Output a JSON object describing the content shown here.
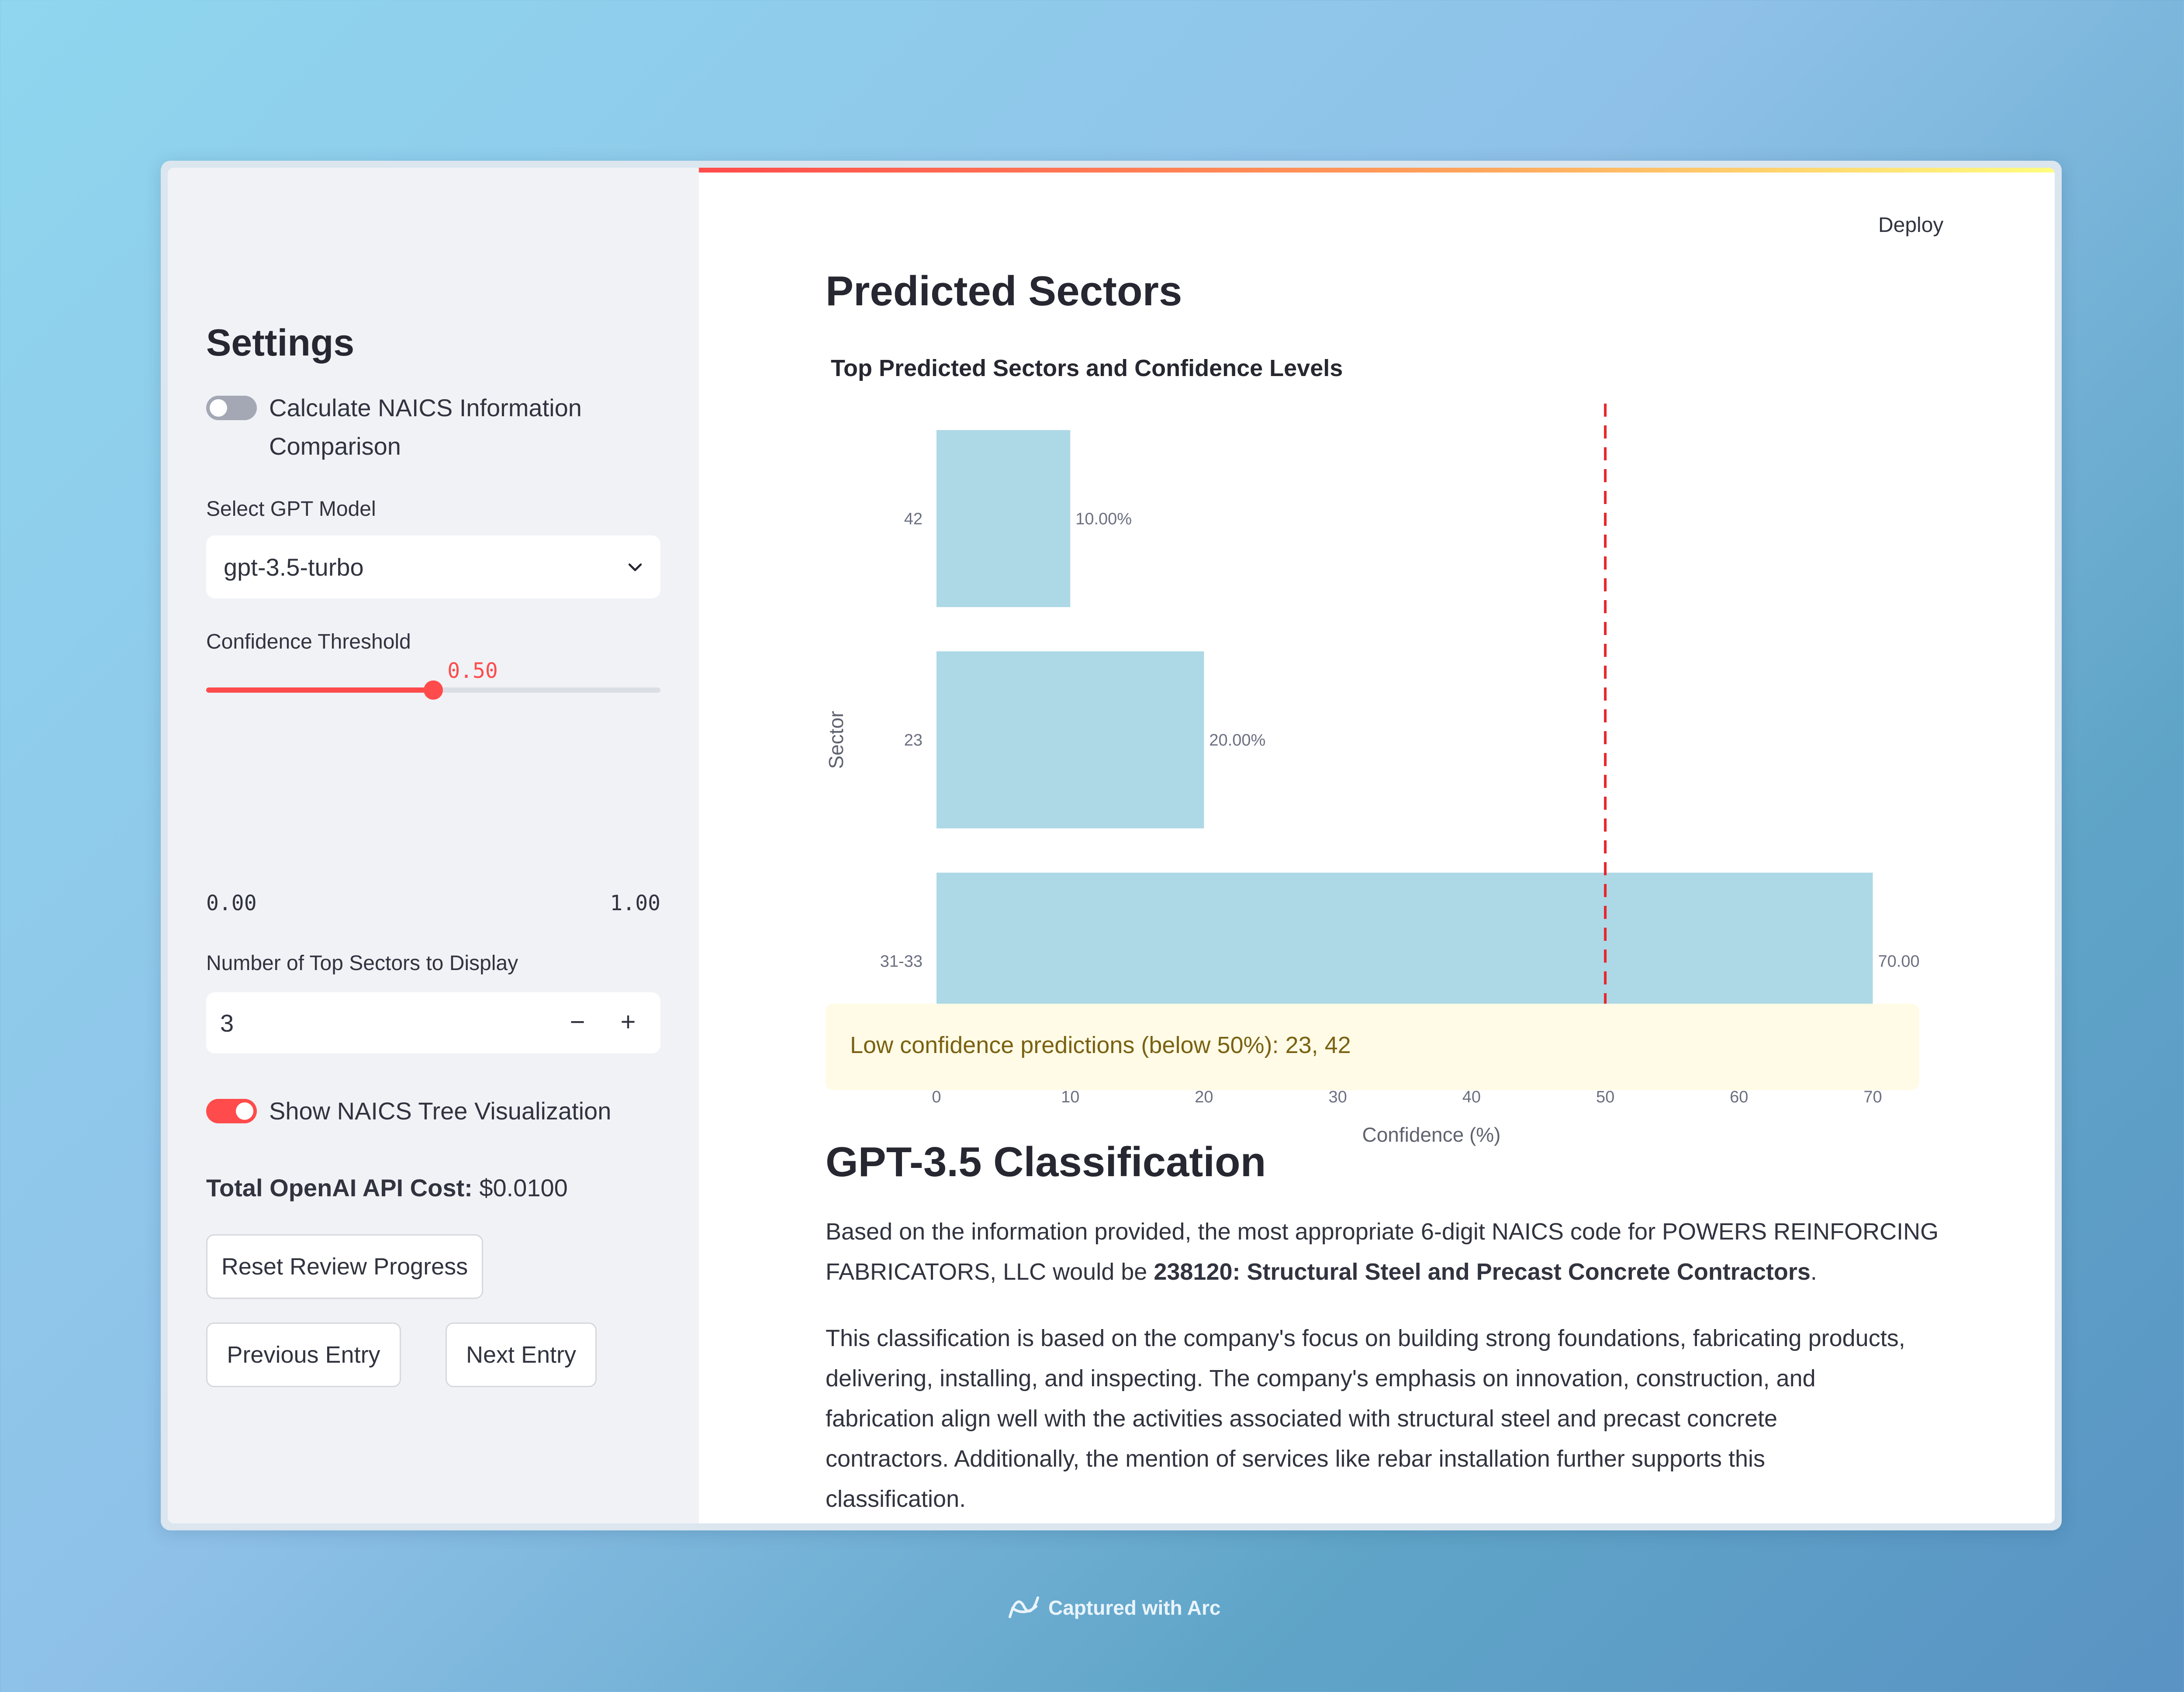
{
  "header": {
    "deploy_label": "Deploy",
    "menu_icon": "vertical-dots-icon"
  },
  "sidebar": {
    "title": "Settings",
    "toggle_naics_label_line1": "Calculate NAICS Information",
    "toggle_naics_label_line2": "Comparison",
    "toggle_naics_on": false,
    "model_label": "Select GPT Model",
    "model_value": "gpt-3.5-turbo",
    "threshold_label": "Confidence Threshold",
    "threshold_value": "0.50",
    "threshold_min": "0.00",
    "threshold_max": "1.00",
    "threshold_fraction": 0.5,
    "top_sectors_label": "Number of Top Sectors to Display",
    "top_sectors_value": "3",
    "minus_label": "−",
    "plus_label": "+",
    "tree_toggle_label": "Show NAICS Tree Visualization",
    "tree_toggle_on": true,
    "cost_label": "Total OpenAI API Cost:",
    "cost_value": "$0.0100",
    "reset_button": "Reset Review Progress",
    "prev_button": "Previous Entry",
    "next_button": "Next Entry"
  },
  "main": {
    "section_title": "Predicted Sectors",
    "alert_text": "Low confidence predictions (below 50%): 23, 42",
    "classification_title": "GPT-3.5 Classification",
    "para1_line1": "Based on the information provided, the most appropriate 6-digit NAICS code for POWERS REINFORCING",
    "para1_line2_pre": "FABRICATORS, LLC would be ",
    "para1_line2_bold": "238120: Structural Steel and Precast Concrete Contractors",
    "para1_line2_post": ".",
    "para2_lines": [
      "This classification is based on the company's focus on building strong foundations, fabricating products,",
      "delivering, installing, and inspecting. The company's emphasis on innovation, construction, and",
      "fabrication align well with the activities associated with structural steel and precast concrete",
      "contractors. Additionally, the mention of services like rebar installation further supports this",
      "classification."
    ]
  },
  "footer": {
    "capture_text": "Captured with Arc"
  },
  "chart_data": {
    "type": "bar",
    "orientation": "horizontal",
    "title": "Top Predicted Sectors and Confidence Levels",
    "xlabel": "Confidence (%)",
    "ylabel": "Sector",
    "categories": [
      "42",
      "23",
      "31-33"
    ],
    "values": [
      10,
      20,
      70
    ],
    "data_labels": [
      "10.00%",
      "20.00%",
      "70.00"
    ],
    "xlim": [
      0,
      74
    ],
    "xticks": [
      0,
      10,
      20,
      30,
      40,
      50,
      60,
      70
    ],
    "threshold_line": 50,
    "bar_color": "#add8e6",
    "threshold_color": "#e8262b",
    "grid": false
  },
  "colors": {
    "accent": "#ff4b4b",
    "toggle_off": "#a3a8b4",
    "alert_bg": "#fffbe6",
    "alert_text": "#7a6113"
  }
}
